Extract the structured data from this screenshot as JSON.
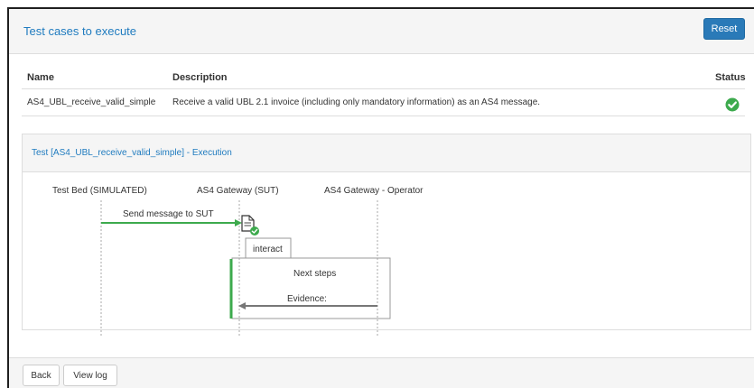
{
  "panel": {
    "title": "Test cases to execute",
    "reset_label": "Reset"
  },
  "table": {
    "columns": {
      "name": "Name",
      "description": "Description",
      "status": "Status"
    },
    "rows": [
      {
        "name": "AS4_UBL_receive_valid_simple",
        "description": "Receive a valid UBL 2.1 invoice (including only mandatory information) as an AS4 message.",
        "status_icon": "check-circle-icon",
        "status_color": "#3daa4d"
      }
    ]
  },
  "execution": {
    "title": "Test [AS4_UBL_receive_valid_simple] - Execution",
    "lanes": [
      "Test Bed (SIMULATED)",
      "AS4 Gateway (SUT)",
      "AS4 Gateway - Operator"
    ],
    "message_label": "Send message to SUT",
    "interact_label": "interact",
    "next_steps_label": "Next steps",
    "evidence_label": "Evidence:",
    "success_color": "#3daa4d",
    "arrow_color": "#777777"
  },
  "footer": {
    "back_label": "Back",
    "view_log_label": "View log"
  }
}
